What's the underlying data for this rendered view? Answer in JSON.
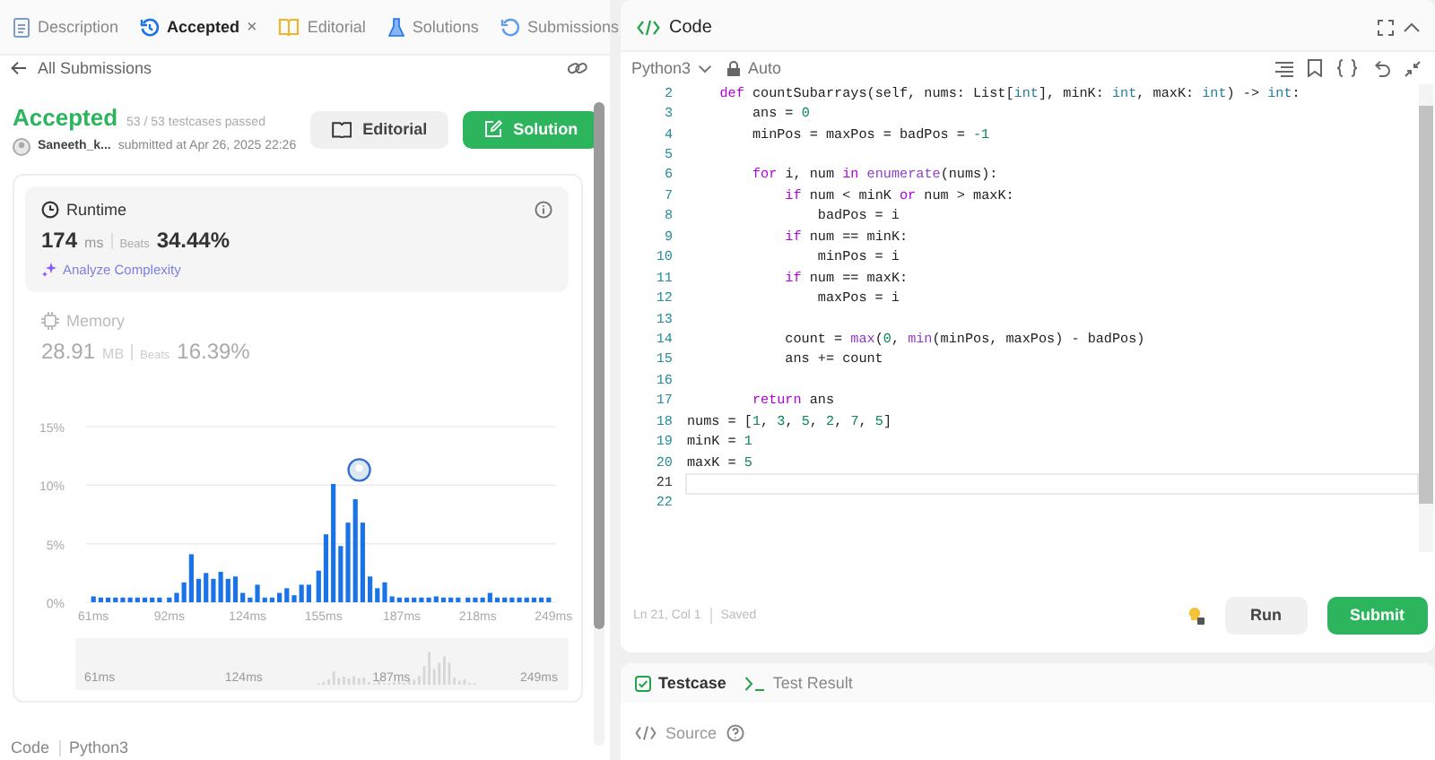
{
  "tabs": [
    {
      "label": "Description",
      "kind": "description",
      "selected": false
    },
    {
      "label": "Accepted",
      "kind": "accepted",
      "selected": true,
      "close_label": "×"
    },
    {
      "label": "Editorial",
      "kind": "editorial",
      "selected": false
    },
    {
      "label": "Solutions",
      "kind": "solutions",
      "selected": false
    },
    {
      "label": "Submissions",
      "kind": "submissions",
      "selected": false
    }
  ],
  "back_link": "All Submissions",
  "submission": {
    "status": "Accepted",
    "passed": "53 / 53 testcases passed",
    "user": "Saneeth_k...",
    "submitted": "submitted at Apr 26, 2025 22:26",
    "buttons": [
      {
        "label": "Editorial",
        "kind": "secondary"
      },
      {
        "label": "Solution",
        "kind": "primary"
      }
    ]
  },
  "metrics": [
    {
      "title": "Runtime",
      "kind": "runtime",
      "value": "174",
      "unit": "ms",
      "beats_label": "Beats",
      "beats": "34.44%",
      "selected": true,
      "action": "Analyze Complexity"
    },
    {
      "title": "Memory",
      "kind": "memory",
      "value": "28.91",
      "unit": "MB",
      "beats_label": "Beats",
      "beats": "16.39%",
      "selected": false
    }
  ],
  "distribution": {
    "chart_data": {
      "type": "bar",
      "xlim": [
        58,
        250
      ],
      "ylim": [
        0,
        15
      ],
      "xticks": [
        {
          "value": 61,
          "label": "61ms"
        },
        {
          "value": 92,
          "label": "92ms"
        },
        {
          "value": 124,
          "label": "124ms"
        },
        {
          "value": 155,
          "label": "155ms"
        },
        {
          "value": 187,
          "label": "187ms"
        },
        {
          "value": 218,
          "label": "218ms"
        },
        {
          "value": 249,
          "label": "249ms"
        }
      ],
      "yticks": [
        {
          "value": 0,
          "label": "0%"
        },
        {
          "value": 5,
          "label": "5%"
        },
        {
          "value": 10,
          "label": "10%"
        },
        {
          "value": 15,
          "label": "15%"
        }
      ],
      "x": [
        61,
        64,
        67,
        70,
        73,
        76,
        79,
        82,
        85,
        88,
        92,
        95,
        98,
        101,
        104,
        107,
        110,
        113,
        116,
        119,
        122,
        125,
        128,
        131,
        134,
        137,
        140,
        143,
        146,
        149,
        153,
        156,
        159,
        162,
        165,
        168,
        171,
        174,
        177,
        180,
        183,
        186,
        189,
        192,
        195,
        198,
        201,
        204,
        207,
        210,
        214,
        217,
        220,
        223,
        226,
        229,
        232,
        235,
        238,
        241,
        244,
        247
      ],
      "series": [
        {
          "color": "#1a73e8",
          "values": [
            0.5,
            0.4,
            0.4,
            0.4,
            0.4,
            0.4,
            0.4,
            0.4,
            0.4,
            0.4,
            0.4,
            0.8,
            1.7,
            4.1,
            2.0,
            2.5,
            2.0,
            2.6,
            2.0,
            2.2,
            0.8,
            0.4,
            1.5,
            0.4,
            0.4,
            0.8,
            1.2,
            0.6,
            1.5,
            1.5,
            2.7,
            5.8,
            10.1,
            4.8,
            6.8,
            8.8,
            6.8,
            2.2,
            1.2,
            1.7,
            0.5,
            0.4,
            0.4,
            0.4,
            0.4,
            0.4,
            0.5,
            0.4,
            0.4,
            0.4,
            0.4,
            0.4,
            0.4,
            0.8,
            0.4,
            0.4,
            0.4,
            0.4,
            0.4,
            0.4,
            0.4,
            0.4
          ]
        }
      ]
    },
    "overview_labels": [
      "61ms",
      "124ms",
      "187ms",
      "249ms"
    ]
  },
  "footer": {
    "label": "Code",
    "language": "Python3"
  },
  "editor": {
    "title": "Code",
    "language": "Python3",
    "mode": "Auto",
    "lines": [
      {
        "number": "2",
        "current": false,
        "tokens": [
          {
            "text": "    def",
            "kind": "keyword"
          },
          {
            "text": " countSubarrays(self, nums: List[",
            "kind": "plain"
          },
          {
            "text": "int",
            "kind": "type"
          },
          {
            "text": "], minK: ",
            "kind": "plain"
          },
          {
            "text": "int",
            "kind": "type"
          },
          {
            "text": ", maxK: ",
            "kind": "plain"
          },
          {
            "text": "int",
            "kind": "type"
          },
          {
            "text": ") -> ",
            "kind": "plain"
          },
          {
            "text": "int",
            "kind": "type"
          },
          {
            "text": ":",
            "kind": "plain"
          }
        ]
      },
      {
        "number": "3",
        "current": false,
        "tokens": [
          {
            "text": "        ans = ",
            "kind": "plain"
          },
          {
            "text": "0",
            "kind": "number"
          }
        ]
      },
      {
        "number": "4",
        "current": false,
        "tokens": [
          {
            "text": "        minPos = maxPos = badPos = ",
            "kind": "plain"
          },
          {
            "text": "-1",
            "kind": "number"
          }
        ]
      },
      {
        "number": "5",
        "current": false
      },
      {
        "number": "6",
        "current": false,
        "tokens": [
          {
            "text": "        for",
            "kind": "keyword"
          },
          {
            "text": " i, num ",
            "kind": "plain"
          },
          {
            "text": "in",
            "kind": "keyword"
          },
          {
            "text": " enumerate",
            "kind": "function"
          },
          {
            "text": "(nums):",
            "kind": "plain"
          }
        ]
      },
      {
        "number": "7",
        "current": false,
        "tokens": [
          {
            "text": "            if",
            "kind": "keyword"
          },
          {
            "text": " num < minK ",
            "kind": "plain"
          },
          {
            "text": "or",
            "kind": "keyword"
          },
          {
            "text": " num > maxK:",
            "kind": "plain"
          }
        ]
      },
      {
        "number": "8",
        "current": false,
        "tokens": [
          {
            "text": "                badPos = i",
            "kind": "plain"
          }
        ]
      },
      {
        "number": "9",
        "current": false,
        "tokens": [
          {
            "text": "            if",
            "kind": "keyword"
          },
          {
            "text": " num == minK:",
            "kind": "plain"
          }
        ]
      },
      {
        "number": "10",
        "current": false,
        "tokens": [
          {
            "text": "                minPos = i",
            "kind": "plain"
          }
        ]
      },
      {
        "number": "11",
        "current": false,
        "tokens": [
          {
            "text": "            if",
            "kind": "keyword"
          },
          {
            "text": " num == maxK:",
            "kind": "plain"
          }
        ]
      },
      {
        "number": "12",
        "current": false,
        "tokens": [
          {
            "text": "                maxPos = i",
            "kind": "plain"
          }
        ]
      },
      {
        "number": "13",
        "current": false
      },
      {
        "number": "14",
        "current": false,
        "tokens": [
          {
            "text": "            count = ",
            "kind": "plain"
          },
          {
            "text": "max",
            "kind": "function"
          },
          {
            "text": "(",
            "kind": "plain"
          },
          {
            "text": "0",
            "kind": "number"
          },
          {
            "text": ", ",
            "kind": "plain"
          },
          {
            "text": "min",
            "kind": "function"
          },
          {
            "text": "(minPos, maxPos) - badPos)",
            "kind": "plain"
          }
        ]
      },
      {
        "number": "15",
        "current": false,
        "tokens": [
          {
            "text": "            ans += count",
            "kind": "plain"
          }
        ]
      },
      {
        "number": "16",
        "current": false
      },
      {
        "number": "17",
        "current": false,
        "tokens": [
          {
            "text": "        return",
            "kind": "keyword"
          },
          {
            "text": " ans",
            "kind": "plain"
          }
        ]
      },
      {
        "number": "18",
        "current": false,
        "tokens": [
          {
            "text": "nums = [",
            "kind": "plain"
          },
          {
            "text": "1",
            "kind": "number"
          },
          {
            "text": ", ",
            "kind": "plain"
          },
          {
            "text": "3",
            "kind": "number"
          },
          {
            "text": ", ",
            "kind": "plain"
          },
          {
            "text": "5",
            "kind": "number"
          },
          {
            "text": ", ",
            "kind": "plain"
          },
          {
            "text": "2",
            "kind": "number"
          },
          {
            "text": ", ",
            "kind": "plain"
          },
          {
            "text": "7",
            "kind": "number"
          },
          {
            "text": ", ",
            "kind": "plain"
          },
          {
            "text": "5",
            "kind": "number"
          },
          {
            "text": "]",
            "kind": "plain"
          }
        ]
      },
      {
        "number": "19",
        "current": false,
        "tokens": [
          {
            "text": "minK = ",
            "kind": "plain"
          },
          {
            "text": "1",
            "kind": "number"
          }
        ]
      },
      {
        "number": "20",
        "current": false,
        "tokens": [
          {
            "text": "maxK = ",
            "kind": "plain"
          },
          {
            "text": "5",
            "kind": "number"
          }
        ]
      },
      {
        "number": "21",
        "current": true
      },
      {
        "number": "22",
        "current": false
      }
    ],
    "position": "Ln 21, Col 1",
    "save_state": "Saved",
    "buttons": [
      {
        "label": "Run",
        "kind": "secondary"
      },
      {
        "label": "Submit",
        "kind": "primary"
      }
    ]
  },
  "console": {
    "tabs": [
      {
        "label": "Testcase",
        "kind": "testcase",
        "selected": true
      },
      {
        "label": "Test Result",
        "kind": "result",
        "selected": false
      }
    ],
    "source": "Source"
  }
}
